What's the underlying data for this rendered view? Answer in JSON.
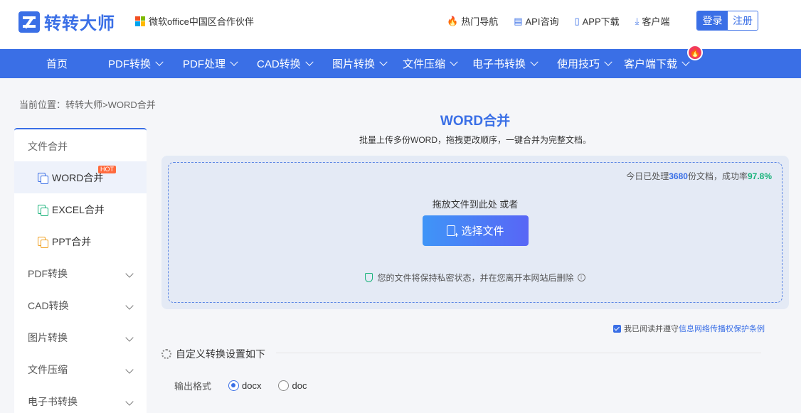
{
  "header": {
    "logo_text": "转转大师",
    "partner": "微软office中国区合作伙伴",
    "links": [
      {
        "label": "热门导航",
        "icon": "fire-icon"
      },
      {
        "label": "API咨询",
        "icon": "chat-icon"
      },
      {
        "label": "APP下载",
        "icon": "phone-icon"
      },
      {
        "label": "客户端",
        "icon": "download-icon"
      }
    ],
    "login": "登录",
    "register": "注册"
  },
  "nav": {
    "items": [
      "首页",
      "PDF转换",
      "PDF处理",
      "CAD转换",
      "图片转换",
      "文件压缩",
      "电子书转换",
      "使用技巧",
      "客户端下载"
    ],
    "badge": "🔥"
  },
  "breadcrumb": "当前位置：转转大师>WORD合并",
  "sidebar": {
    "head": "文件合并",
    "subs": [
      {
        "label": "WORD合并",
        "color": "#3a6fe6"
      },
      {
        "label": "EXCEL合并",
        "color": "#19b37a"
      },
      {
        "label": "PPT合并",
        "color": "#f0a020"
      }
    ],
    "hot": "HOT",
    "cats": [
      "PDF转换",
      "CAD转换",
      "图片转换",
      "文件压缩",
      "电子书转换"
    ]
  },
  "main": {
    "title": "WORD合并",
    "subtitle": "批量上传多份WORD，拖拽更改顺序，一键合并为完整文档。",
    "stats_prefix": "今日已处理",
    "stats_count": "3680",
    "stats_mid": "份文档，成功率",
    "stats_rate": "97.8%",
    "drop_text": "拖放文件到此处 或者",
    "select_button": "选择文件",
    "privacy": "您的文件将保持私密状态，并在您离开本网站后删除",
    "agree_text": "我已阅读并遵守",
    "agree_link": "信息网络传播权保护条例",
    "settings_title": "自定义转换设置如下",
    "format_label": "输出格式",
    "format_options": [
      "docx",
      "doc"
    ],
    "format_selected": "docx"
  }
}
